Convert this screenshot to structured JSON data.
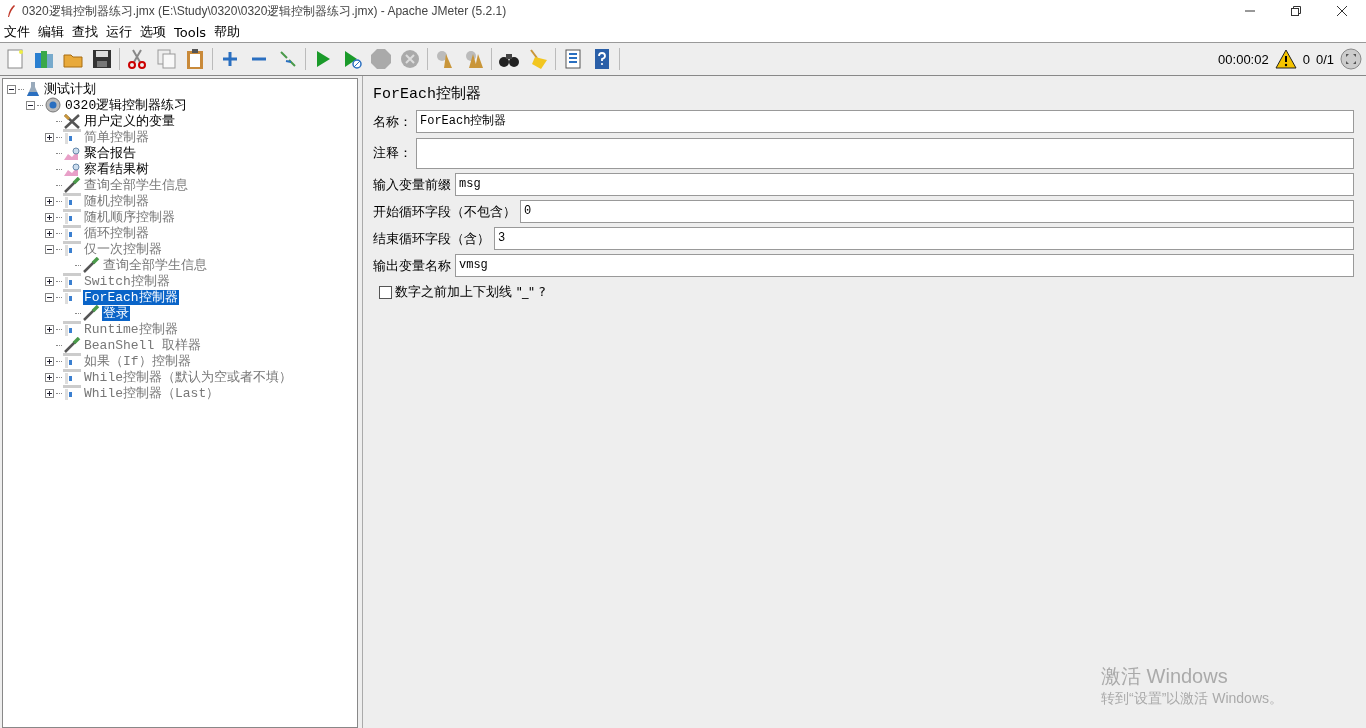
{
  "window": {
    "title": "0320逻辑控制器练习.jmx (E:\\Study\\0320\\0320逻辑控制器练习.jmx) - Apache JMeter (5.2.1)"
  },
  "menu": [
    {
      "label": "文件"
    },
    {
      "label": "编辑"
    },
    {
      "label": "查找"
    },
    {
      "label": "运行"
    },
    {
      "label": "选项"
    },
    {
      "label": "Tools"
    },
    {
      "label": "帮助"
    }
  ],
  "status": {
    "elapsed": "00:00:02",
    "warnings": "0",
    "threads": "0/1"
  },
  "tree": [
    {
      "label": "测试计划",
      "kind": "plan",
      "disabled": false,
      "selected": false,
      "expanded": true,
      "children": [
        {
          "label": "0320逻辑控制器练习",
          "kind": "group",
          "disabled": false,
          "selected": false,
          "expanded": true,
          "children": [
            {
              "label": "用户定义的变量",
              "kind": "config",
              "disabled": false,
              "selected": false
            },
            {
              "label": "简单控制器",
              "kind": "controller",
              "disabled": true,
              "selected": false,
              "expanded": false
            },
            {
              "label": "聚合报告",
              "kind": "listener",
              "disabled": false,
              "selected": false
            },
            {
              "label": "察看结果树",
              "kind": "listener",
              "disabled": false,
              "selected": false
            },
            {
              "label": "查询全部学生信息",
              "kind": "sampler",
              "disabled": true,
              "selected": false
            },
            {
              "label": "随机控制器",
              "kind": "controller",
              "disabled": true,
              "selected": false,
              "expanded": false
            },
            {
              "label": "随机顺序控制器",
              "kind": "controller",
              "disabled": true,
              "selected": false,
              "expanded": false
            },
            {
              "label": "循环控制器",
              "kind": "controller",
              "disabled": true,
              "selected": false,
              "expanded": false
            },
            {
              "label": "仅一次控制器",
              "kind": "controller",
              "disabled": true,
              "selected": false,
              "expanded": true,
              "children": [
                {
                  "label": "查询全部学生信息",
                  "kind": "sampler",
                  "disabled": true,
                  "selected": false
                }
              ]
            },
            {
              "label": "Switch控制器",
              "kind": "controller",
              "disabled": true,
              "selected": false,
              "expanded": false
            },
            {
              "label": "ForEach控制器",
              "kind": "controller",
              "disabled": false,
              "selected": true,
              "expanded": true,
              "children": [
                {
                  "label": "登录",
                  "kind": "sampler",
                  "disabled": false,
                  "selected": true
                }
              ]
            },
            {
              "label": "Runtime控制器",
              "kind": "controller",
              "disabled": true,
              "selected": false,
              "expanded": false
            },
            {
              "label": "BeanShell 取样器",
              "kind": "sampler",
              "disabled": true,
              "selected": false
            },
            {
              "label": "如果（If）控制器",
              "kind": "controller",
              "disabled": true,
              "selected": false,
              "expanded": false
            },
            {
              "label": "While控制器（默认为空或者不填）",
              "kind": "controller",
              "disabled": true,
              "selected": false,
              "expanded": false
            },
            {
              "label": "While控制器（Last）",
              "kind": "controller",
              "disabled": true,
              "selected": false,
              "expanded": false
            }
          ]
        }
      ]
    }
  ],
  "panel": {
    "title": "ForEach控制器",
    "fields": [
      {
        "label": "名称：",
        "value": "ForEach控制器",
        "kind": "text"
      },
      {
        "label": "注释：",
        "kind": "area"
      },
      {
        "label": "输入变量前缀",
        "value": "msg",
        "kind": "text"
      },
      {
        "label": "开始循环字段（不包含）",
        "value": "0",
        "kind": "text"
      },
      {
        "label": "结束循环字段（含）",
        "value": "3",
        "kind": "text"
      },
      {
        "label": "输出变量名称",
        "value": "vmsg",
        "kind": "text"
      }
    ],
    "checkbox": {
      "label": "数字之前加上下划线 \"_\" ?",
      "checked": false
    }
  },
  "activation": {
    "title": "激活 Windows",
    "subtitle": "转到“设置”以激活 Windows。"
  }
}
